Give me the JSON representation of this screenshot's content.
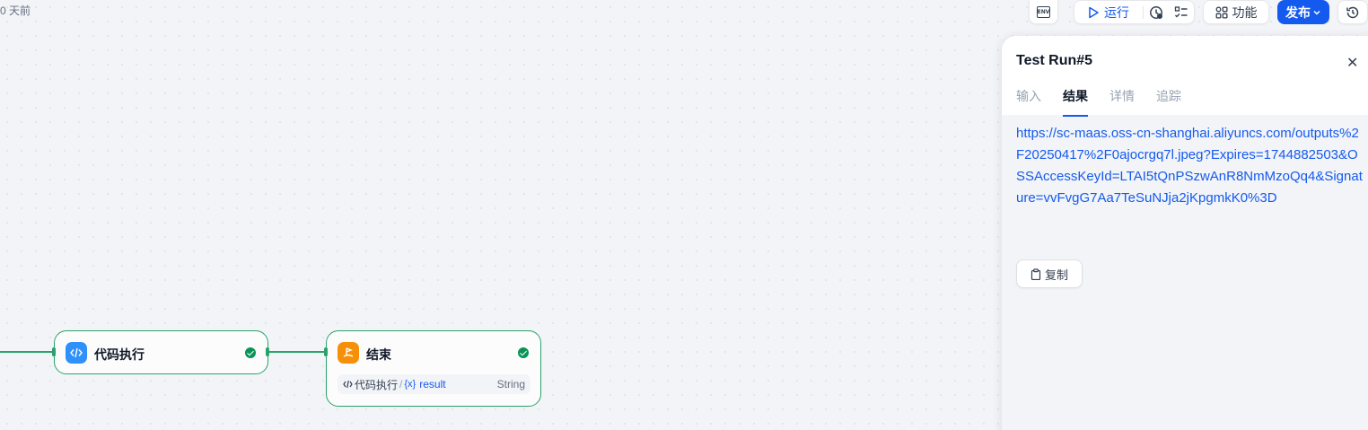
{
  "header": {
    "saved_text": "0 天前",
    "env_label": "ENV",
    "run_label": "运行",
    "features_label": "功能",
    "publish_label": "发布",
    "accent": "#155aef"
  },
  "panel": {
    "title": "Test Run#5",
    "tabs": [
      {
        "label": "输入",
        "active": false
      },
      {
        "label": "结果",
        "active": true
      },
      {
        "label": "详情",
        "active": false
      },
      {
        "label": "追踪",
        "active": false
      }
    ],
    "result": "https://sc-maas.oss-cn-shanghai.aliyuncs.com/outputs%2F20250417%2F0ajocrgq7l.jpeg?Expires=1744882503&OSSAccessKeyId=LTAI5tQnPSzwAnR8NmMzoQq4&Signature=vvFvgG7Aa7TeSuNJja2jKpgmkK0%3D",
    "copy_label": "复制"
  },
  "nodes": {
    "code": {
      "title": "代码执行",
      "icon": "code-icon",
      "color": "#2e90fa",
      "status": "success"
    },
    "end": {
      "title": "结束",
      "icon": "end-flag-icon",
      "color": "#f79009",
      "status": "success",
      "output": {
        "source": "代码执行",
        "variable": "result",
        "type": "String"
      }
    }
  }
}
